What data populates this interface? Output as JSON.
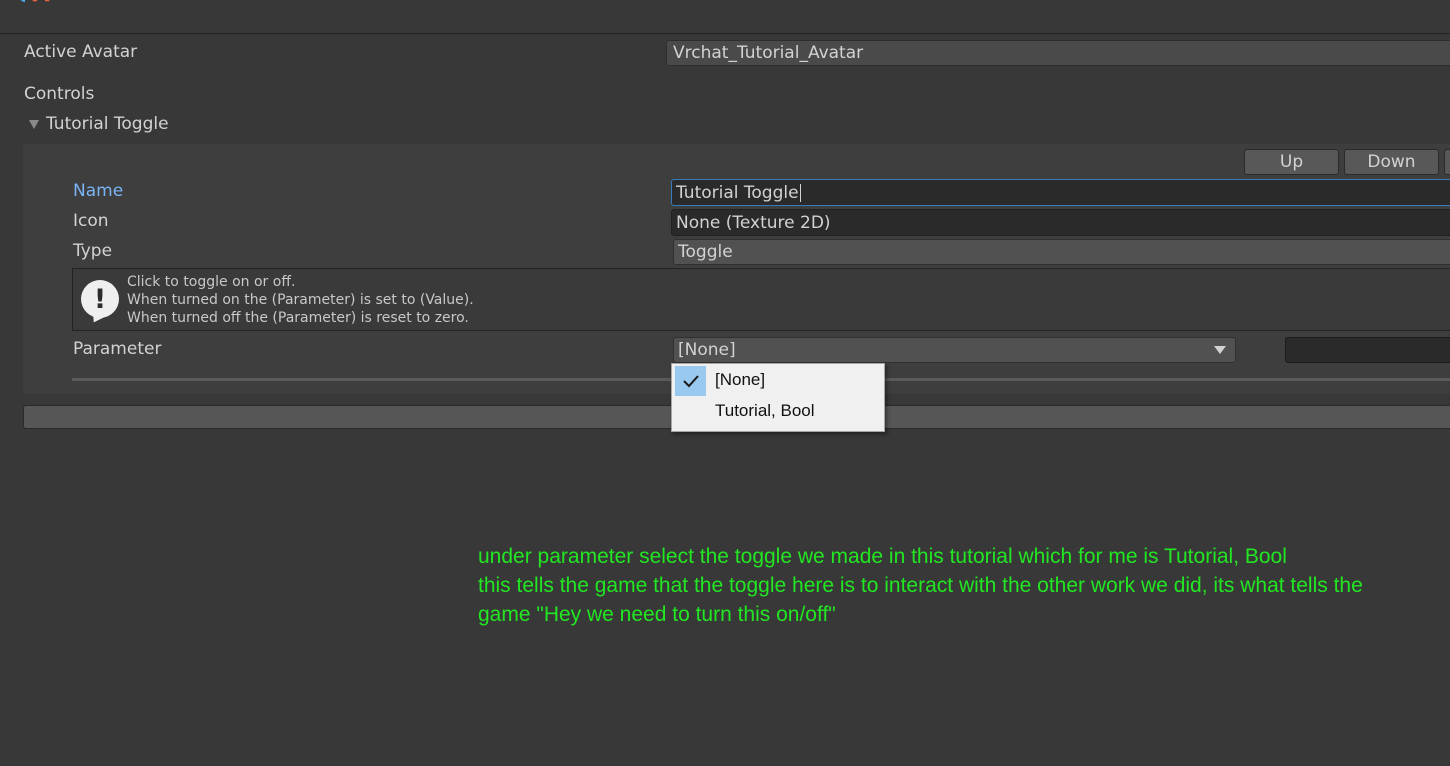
{
  "colors": {
    "background": "#383838",
    "panel": "#3e3e3e",
    "field": "#2a2a2a",
    "highlight_label": "#7ab4f5",
    "focus_border": "#3a79bb",
    "annotation": "#22e622",
    "menu_check": "#99c9ef"
  },
  "header": {
    "logo_icon": "tool-logo-icon"
  },
  "active_avatar": {
    "label": "Active Avatar",
    "value": "Vrchat_Tutorial_Avatar"
  },
  "controls": {
    "heading": "Controls",
    "foldout_label": "Tutorial Toggle",
    "up_label": "Up",
    "down_label": "Down",
    "name_label": "Name",
    "name_value": "Tutorial Toggle",
    "icon_label": "Icon",
    "icon_value": "None (Texture 2D)",
    "type_label": "Type",
    "type_value": "Toggle",
    "help": {
      "icon": "info-icon",
      "lines": [
        "Click to toggle on or off.",
        "When turned on the (Parameter) is set to (Value).",
        "When turned off the (Parameter) is reset to zero."
      ]
    },
    "parameter_label": "Parameter",
    "parameter_value": "[None]"
  },
  "dropdown": {
    "options": [
      {
        "label": "[None]",
        "selected": true
      },
      {
        "label": "Tutorial, Bool",
        "selected": false
      }
    ]
  },
  "annotation": {
    "lines": [
      "under parameter select the toggle we made in this tutorial which for me is Tutorial, Bool",
      "this tells the game that the toggle here is to interact with the other work we did, its what tells the",
      "game \"Hey we need to turn this on/off\""
    ]
  }
}
